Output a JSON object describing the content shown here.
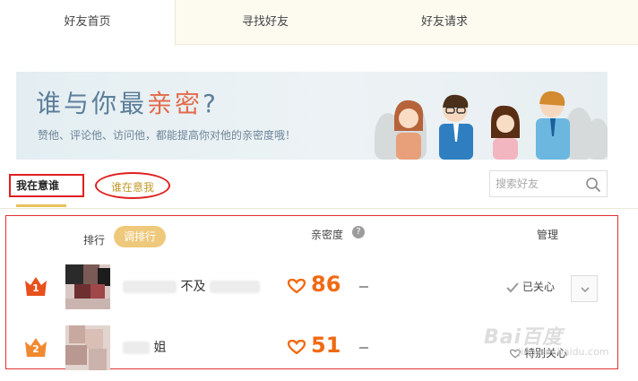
{
  "tabs": [
    {
      "label": "好友首页",
      "active": true
    },
    {
      "label": "寻找好友",
      "active": false
    },
    {
      "label": "好友请求",
      "active": false
    }
  ],
  "banner": {
    "title_prefix": "谁与你最",
    "title_highlight": "亲密",
    "title_suffix": "?",
    "subtitle": "赞他、评论他、访问他，都能提高你对他的亲密度哦！"
  },
  "subtabs": [
    {
      "label": "我在意谁",
      "active": true
    },
    {
      "label": "谁在意我",
      "active": false
    }
  ],
  "search": {
    "placeholder": "搜索好友",
    "icon": "search-icon"
  },
  "table": {
    "rank_label": "排行",
    "sort_button": "调排行",
    "intimacy_label": "亲密度",
    "help_icon": "?",
    "manage_label": "管理"
  },
  "rows": [
    {
      "rank": "1",
      "name_visible": "不及",
      "score": "86",
      "manage": "已关心",
      "manage_icon": "check-icon"
    },
    {
      "rank": "2",
      "name_visible": "姐",
      "score": "51",
      "manage": "特别关心",
      "manage_icon": "heart-outline-icon"
    }
  ],
  "watermark": {
    "logo": "Bai百度",
    "caption": "jingyan.baidu.com"
  },
  "colors": {
    "accent": "#f06a12",
    "gold": "#eec97b",
    "annotation": "#e02020",
    "tab_bg": "#fdfbf0"
  }
}
